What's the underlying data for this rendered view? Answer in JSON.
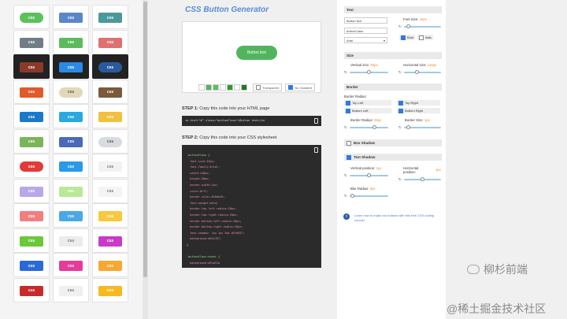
{
  "gallery": {
    "rows": [
      [
        {
          "label": "css",
          "color": "#5bc15b",
          "shape": "pill"
        },
        {
          "label": "css",
          "color": "#5b87c9",
          "shape": "rect"
        },
        {
          "label": "css",
          "color": "#4a9a9a",
          "shape": "rect"
        }
      ],
      [
        {
          "label": "css",
          "color": "#707d86",
          "shape": "rect"
        },
        {
          "label": "css",
          "color": "#5bbb5b",
          "shape": "rect"
        },
        {
          "label": "css",
          "color": "#e07070",
          "shape": "rect"
        }
      ],
      [
        {
          "label": "css",
          "color": "#8b3a2a",
          "shape": "rect",
          "dark": true
        },
        {
          "label": "css",
          "color": "#2a8ae8",
          "shape": "rect",
          "dark": true
        },
        {
          "label": "css",
          "color": "#2a5a9e",
          "shape": "pill",
          "dark": true
        }
      ],
      [
        {
          "label": "css",
          "color": "#e05a2a",
          "shape": "rect"
        },
        {
          "label": "css",
          "color": "#e0d8b8",
          "shape": "pill",
          "textColor": "#555"
        },
        {
          "label": "css",
          "color": "#7a5a3a",
          "shape": "rect"
        }
      ],
      [
        {
          "label": "css",
          "color": "#1a7ac8",
          "shape": "rect"
        },
        {
          "label": "css",
          "color": "#2aa8e0",
          "shape": "rect"
        },
        {
          "label": "css",
          "color": "#f0c040",
          "shape": "rect"
        }
      ],
      [
        {
          "label": "css",
          "color": "#7ab55a",
          "shape": "rect"
        },
        {
          "label": "css",
          "color": "#4a6ab8",
          "shape": "rect"
        },
        {
          "label": "css",
          "color": "#d8dbe0",
          "shape": "pill",
          "textColor": "#555"
        }
      ],
      [
        {
          "label": "css",
          "color": "#e03a3a",
          "shape": "pill"
        },
        {
          "label": "css",
          "color": "#2a9ae8",
          "shape": "rect"
        },
        {
          "label": "css",
          "color": "#f2f2f2",
          "shape": "rect",
          "textColor": "#777"
        }
      ],
      [
        {
          "label": "css",
          "color": "#b8a8e8",
          "shape": "rect"
        },
        {
          "label": "css",
          "color": "#b8e898",
          "shape": "rect"
        },
        {
          "label": "css",
          "color": "#f4f4f4",
          "shape": "rect",
          "textColor": "#777"
        }
      ],
      [
        {
          "label": "css",
          "color": "#f08080",
          "shape": "rect"
        },
        {
          "label": "css",
          "color": "#4aa8e8",
          "shape": "rect"
        },
        {
          "label": "css",
          "color": "#f8c840",
          "shape": "rect"
        }
      ],
      [
        {
          "label": "css",
          "color": "#6ac83a",
          "shape": "rect"
        },
        {
          "label": "css",
          "color": "#ececec",
          "shape": "rect",
          "textColor": "#777"
        },
        {
          "label": "css",
          "color": "#c83ac8",
          "shape": "rect"
        }
      ],
      [
        {
          "label": "css",
          "color": "#2a6ad8",
          "shape": "rect"
        },
        {
          "label": "css",
          "color": "#e83a9a",
          "shape": "rect"
        },
        {
          "label": "css",
          "color": "#f8a830",
          "shape": "rect"
        }
      ],
      [
        {
          "label": "css",
          "color": "#c82a2a",
          "shape": "rect"
        },
        {
          "label": "css",
          "color": "#f0f0f0",
          "shape": "rect",
          "textColor": "#777"
        },
        {
          "label": "css",
          "color": "#f8b820",
          "shape": "rect"
        }
      ]
    ]
  },
  "center": {
    "title": "CSS Button Generator",
    "preview_button": "Button text",
    "swatches": [
      "#ffffff",
      "#52b55d",
      "#5bc15b",
      "#ffffff",
      "#2e9a2e",
      "#ffffff",
      "#1e7a1e"
    ],
    "transparent_label": "Transparent",
    "no_gradient_label": "No Gradient",
    "step1_num": "STEP 1:",
    "step1_text": "Copy this code into your HTML page",
    "html_code": "<a href=\"#\" class=\"buttonClass\">Button text</a>",
    "step2_num": "STEP 2:",
    "step2_text": "Copy this code into your CSS stylesheet",
    "css_lines": [
      ".buttonClass {",
      "  font-size:15px;",
      "  font-family:Arial;",
      "  width:140px;",
      "  height:50px;",
      "  border-width:1px;",
      "  color:#fff;",
      "  border-color:#18ab29;",
      "  font-weight:bold;",
      "  border-top-left-radius:28px;",
      "  border-top-right-radius:28px;",
      "  border-bottom-left-radius:28px;",
      "  border-bottom-right-radius:28px;",
      "  text-shadow: 1px 1px 0px #2f6627;",
      "  background:#44c767;",
      "}",
      "",
      ".buttonClass:hover {",
      "  background:#5cbf2a",
      "}"
    ]
  },
  "panel": {
    "text_header": "Text",
    "button_text_value": "Button text",
    "class_value": "buttonClass",
    "font_family": "Arial",
    "font_size_label": "Font Size:",
    "font_size_value": "15px",
    "bold_label": "Bold",
    "italic_label": "Italic",
    "size_header": "Size",
    "vsize_label": "Vertical size:",
    "vsize_value": "50px",
    "hsize_label": "Horizontal size:",
    "hsize_value": "140px",
    "border_header": "Border",
    "border_radius_title": "Border Radius:",
    "top_left": "Top Left",
    "top_right": "Top Right",
    "bottom_left": "Bottom Left",
    "bottom_right": "Bottom Right",
    "radius_label": "Border Radius:",
    "radius_value": "28px",
    "bsize_label": "Border Size:",
    "bsize_value": "1px",
    "box_shadow_header": "Box Shadow",
    "text_shadow_header": "Text Shadow",
    "vpos_label": "Vertical position:",
    "vpos_value": "1px",
    "hpos_label": "Horizontal position:",
    "hpos_value": "1px",
    "blur_label": "Blur Radius:",
    "blur_value": "0px",
    "learn_text": "Learn how to make css buttons with this free CSS coding course!",
    "info_glyph": "i",
    "reset_glyph": "↻"
  },
  "watermark": {
    "line1": "柳杉前端",
    "line2": "@稀土掘金技术社区"
  }
}
